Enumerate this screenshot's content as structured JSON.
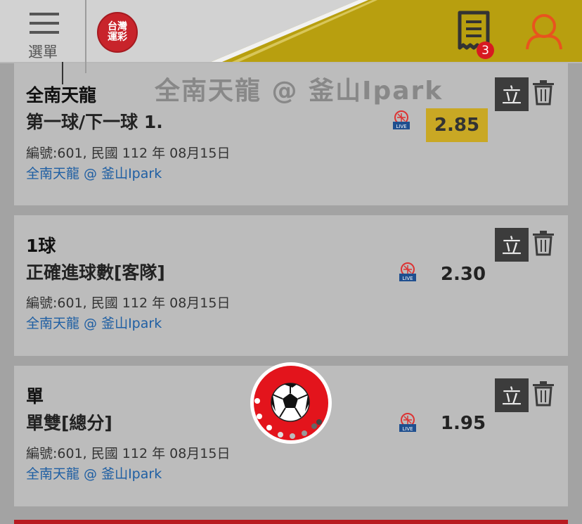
{
  "header": {
    "menu_label": "選單",
    "logo_text_line1": "台灣",
    "logo_text_line2": "運彩",
    "betslip_count": "3",
    "background_color": "#d2d2d2",
    "stripe_color": "#b89f0f",
    "accent_color": "#e8541e"
  },
  "ghost_title": "全南天龍 @ 釜山Ipark",
  "bets": [
    {
      "pick": "全南天龍",
      "market": "第一球/下一球 1.",
      "meta": "編號:601, 民國 112 年 08月15日",
      "match": "全南天龍 @ 釜山Ipark",
      "odds": "2.85",
      "highlighted": true,
      "stand_label": "立",
      "live_icon": "live-icon"
    },
    {
      "pick": "1球",
      "market": "正確進球數[客隊]",
      "meta": "編號:601, 民國 112 年 08月15日",
      "match": "全南天龍 @ 釜山Ipark",
      "odds": "2.30",
      "highlighted": false,
      "stand_label": "立",
      "live_icon": "live-icon"
    },
    {
      "pick": "單",
      "market": "單雙[總分]",
      "meta": "編號:601, 民國 112 年 08月15日",
      "match": "全南天龍 @ 釜山Ipark",
      "odds": "1.95",
      "highlighted": false,
      "stand_label": "立",
      "live_icon": "live-icon"
    }
  ],
  "live_text": "LIVE",
  "floating_button": {
    "icon": "soccer-ball-icon",
    "color": "#e3141c"
  }
}
